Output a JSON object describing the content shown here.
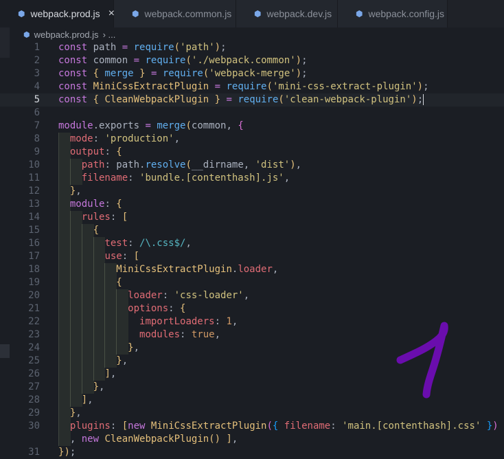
{
  "tabs": [
    {
      "label": "webpack.prod.js",
      "active": true,
      "close": "×"
    },
    {
      "label": "webpack.common.js",
      "active": false
    },
    {
      "label": "webpack.dev.js",
      "active": false
    },
    {
      "label": "webpack.config.js",
      "active": false
    }
  ],
  "breadcrumb": {
    "file": "webpack.prod.js",
    "rest": "› ..."
  },
  "editor": {
    "current_line": 5,
    "lines": [
      {
        "n": "1",
        "code": "const path = require('path');"
      },
      {
        "n": "2",
        "code": "const common = require('./webpack.common');"
      },
      {
        "n": "3",
        "code": "const { merge } = require('webpack-merge');"
      },
      {
        "n": "4",
        "code": "const MiniCssExtractPlugin = require('mini-css-extract-plugin');"
      },
      {
        "n": "5",
        "code": "const { CleanWebpackPlugin } = require('clean-webpack-plugin');"
      },
      {
        "n": "6",
        "code": ""
      },
      {
        "n": "7",
        "code": "module.exports = merge(common, {"
      },
      {
        "n": "8",
        "code": "  mode: 'production',"
      },
      {
        "n": "9",
        "code": "  output: {"
      },
      {
        "n": "10",
        "code": "    path: path.resolve(__dirname, 'dist'),"
      },
      {
        "n": "11",
        "code": "    filename: 'bundle.[contenthash].js',"
      },
      {
        "n": "12",
        "code": "  },"
      },
      {
        "n": "13",
        "code": "  module: {"
      },
      {
        "n": "14",
        "code": "    rules: ["
      },
      {
        "n": "15",
        "code": "      {"
      },
      {
        "n": "16",
        "code": "        test: /\\.css$/,"
      },
      {
        "n": "17",
        "code": "        use: ["
      },
      {
        "n": "18",
        "code": "          MiniCssExtractPlugin.loader,"
      },
      {
        "n": "19",
        "code": "          {"
      },
      {
        "n": "20",
        "code": "            loader: 'css-loader',"
      },
      {
        "n": "21",
        "code": "            options: {"
      },
      {
        "n": "22",
        "code": "              importLoaders: 1,"
      },
      {
        "n": "23",
        "code": "              modules: true,"
      },
      {
        "n": "24",
        "code": "            },"
      },
      {
        "n": "25",
        "code": "          },"
      },
      {
        "n": "26",
        "code": "        ],"
      },
      {
        "n": "27",
        "code": "      },"
      },
      {
        "n": "28",
        "code": "    ],"
      },
      {
        "n": "29",
        "code": "  },"
      },
      {
        "n": "30",
        "code": "  plugins: [new MiniCssExtractPlugin({ filename: 'main.[contenthash].css' })"
      },
      {
        "n": "",
        "code": "  , new CleanWebpackPlugin() ],"
      },
      {
        "n": "31",
        "code": "});"
      }
    ]
  },
  "icons": {
    "file_icon": "webpack-cube-icon",
    "close_icon": "close-icon"
  },
  "colors": {
    "background": "#1b1e24",
    "keyword": "#c678dd",
    "function": "#61afef",
    "string": "#d1c27f",
    "property": "#e06c75",
    "annotation": "#6a0dad"
  }
}
